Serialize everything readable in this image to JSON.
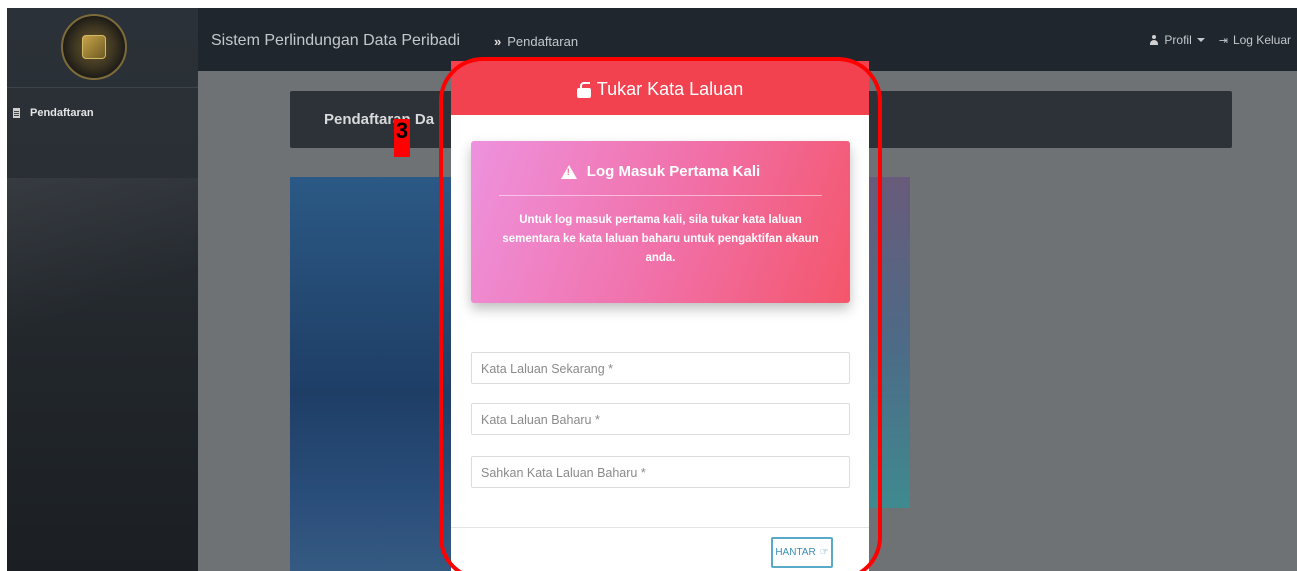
{
  "topbar": {
    "app_title": "Sistem Perlindungan Data Peribadi",
    "breadcrumb_arrow": "»",
    "breadcrumb_current": "Pendaftaran",
    "profile_label": "Profil",
    "logout_label": "Log Keluar"
  },
  "sidebar": {
    "items": [
      {
        "label": "Pendaftaran",
        "icon": "document-icon"
      }
    ]
  },
  "background": {
    "header_text": "Pendaftaran Da"
  },
  "modal": {
    "title": "Tukar Kata Laluan",
    "alert": {
      "title": "Log Masuk Pertama Kali",
      "message": "Untuk log masuk pertama kali, sila tukar kata laluan sementara ke kata laluan baharu untuk pengaktifan akaun anda."
    },
    "fields": {
      "current_placeholder": "Kata Laluan Sekarang *",
      "new_placeholder": "Kata Laluan Baharu *",
      "confirm_placeholder": "Sahkan Kata Laluan Baharu *"
    },
    "submit_label": "HANTAR",
    "header_color": "#f2414f"
  },
  "annotation": {
    "number": "3",
    "color": "#ff0000"
  }
}
